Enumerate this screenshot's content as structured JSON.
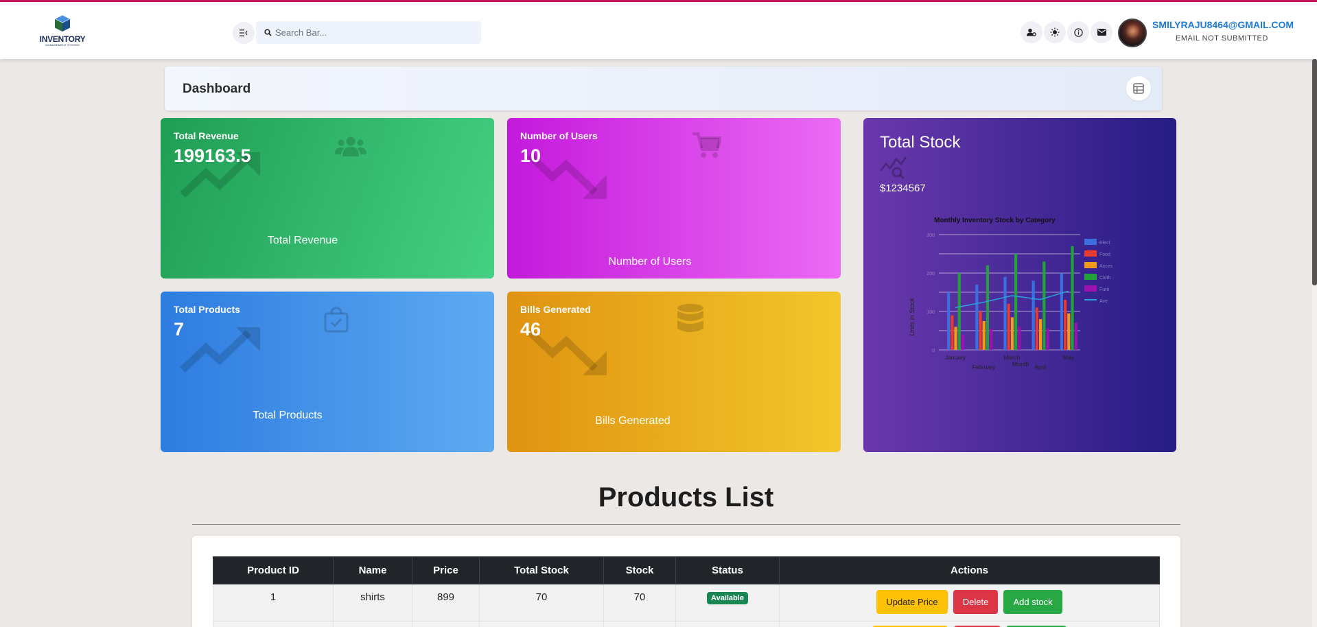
{
  "header": {
    "logo_text": "INVENTORY",
    "logo_sub": "MANAGEMENT SYSTEM",
    "search_placeholder": "Search Bar...",
    "user_email": "SMILYRAJU8464@GMAIL.COM",
    "user_status": "EMAIL NOT SUBMITTED",
    "icons": [
      "menu-toggle-icon",
      "search-icon",
      "user-settings-icon",
      "sun-icon",
      "info-icon",
      "mail-icon"
    ]
  },
  "dashboard": {
    "title": "Dashboard"
  },
  "cards": {
    "revenue": {
      "label": "Total Revenue",
      "value": "199163.5",
      "footer": "Total Revenue",
      "color": "#1f9e54"
    },
    "users": {
      "label": "Number of Users",
      "value": "10",
      "footer": "Number of Users",
      "color": "#c419dc"
    },
    "products": {
      "label": "Total Products",
      "value": "7",
      "footer": "Total Products",
      "color": "#2d7ce0"
    },
    "bills": {
      "label": "Bills Generated",
      "value": "46",
      "footer": "Bills Generated",
      "color": "#e09311"
    }
  },
  "stock": {
    "title": "Total Stock",
    "value": "$1234567"
  },
  "chart_data": {
    "type": "bar",
    "title": "Monthly Inventory Stock by Category",
    "xlabel": "Month",
    "ylabel": "Units in Stock",
    "categories": [
      "January",
      "February",
      "March",
      "April",
      "May"
    ],
    "ylim": [
      0,
      300
    ],
    "y_ticks": [
      "0",
      "100",
      "200",
      "300"
    ],
    "series": [
      {
        "name": "Elect",
        "type": "bar",
        "color": "#3b6fe0",
        "values": [
          150,
          170,
          190,
          180,
          200
        ]
      },
      {
        "name": "Food",
        "type": "bar",
        "color": "#e63b2e",
        "values": [
          90,
          100,
          120,
          110,
          130
        ]
      },
      {
        "name": "Acces",
        "type": "bar",
        "color": "#f39a1b",
        "values": [
          60,
          75,
          85,
          80,
          95
        ]
      },
      {
        "name": "Cloth",
        "type": "bar",
        "color": "#22a33a",
        "values": [
          200,
          220,
          250,
          230,
          270
        ]
      },
      {
        "name": "Furn",
        "type": "bar",
        "color": "#9b12b0",
        "values": [
          40,
          55,
          60,
          55,
          70
        ]
      },
      {
        "name": "Ave",
        "type": "line",
        "color": "#28a7d8",
        "values": [
          110,
          124,
          141,
          131,
          153
        ]
      }
    ],
    "legend": "right",
    "grid": true
  },
  "products": {
    "title": "Products List",
    "columns": [
      "Product ID",
      "Name",
      "Price",
      "Total Stock",
      "Stock",
      "Status",
      "Actions"
    ],
    "rows": [
      {
        "id": "1",
        "name": "shirts",
        "price": "899",
        "total_stock": "70",
        "stock": "70",
        "status": "Available"
      }
    ],
    "actions": {
      "update": "Update Price",
      "delete": "Delete",
      "add": "Add stock"
    }
  }
}
